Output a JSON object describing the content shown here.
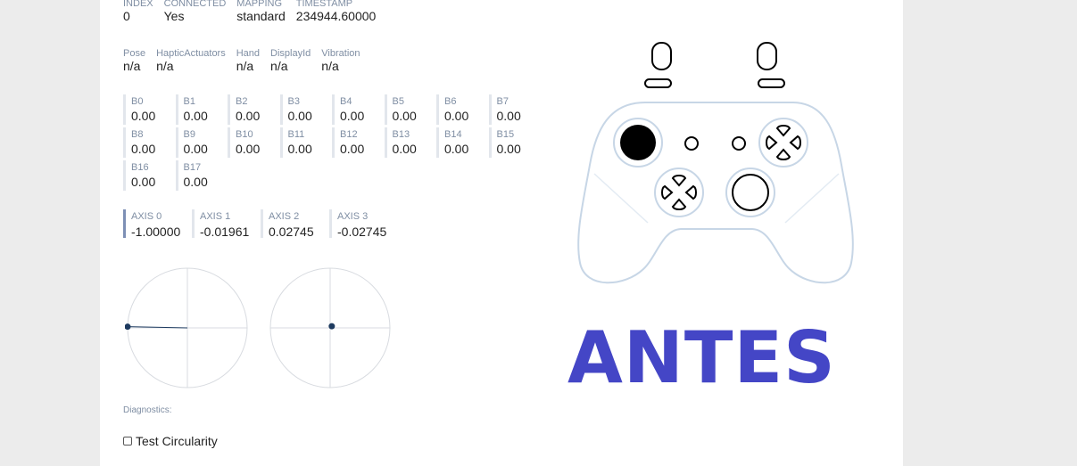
{
  "info": {
    "index": {
      "label": "INDEX",
      "value": "0"
    },
    "connected": {
      "label": "CONNECTED",
      "value": "Yes"
    },
    "mapping": {
      "label": "MAPPING",
      "value": "standard"
    },
    "timestamp": {
      "label": "TIMESTAMP",
      "value": "234944.60000"
    }
  },
  "info2": {
    "pose": {
      "label": "Pose",
      "value": "n/a"
    },
    "haptic": {
      "label": "HapticActuators",
      "value": "n/a"
    },
    "hand": {
      "label": "Hand",
      "value": "n/a"
    },
    "displayid": {
      "label": "DisplayId",
      "value": "n/a"
    },
    "vibration": {
      "label": "Vibration",
      "value": "n/a"
    }
  },
  "buttons": [
    {
      "label": "B0",
      "value": "0.00"
    },
    {
      "label": "B1",
      "value": "0.00"
    },
    {
      "label": "B2",
      "value": "0.00"
    },
    {
      "label": "B3",
      "value": "0.00"
    },
    {
      "label": "B4",
      "value": "0.00"
    },
    {
      "label": "B5",
      "value": "0.00"
    },
    {
      "label": "B6",
      "value": "0.00"
    },
    {
      "label": "B7",
      "value": "0.00"
    },
    {
      "label": "B8",
      "value": "0.00"
    },
    {
      "label": "B9",
      "value": "0.00"
    },
    {
      "label": "B10",
      "value": "0.00"
    },
    {
      "label": "B11",
      "value": "0.00"
    },
    {
      "label": "B12",
      "value": "0.00"
    },
    {
      "label": "B13",
      "value": "0.00"
    },
    {
      "label": "B14",
      "value": "0.00"
    },
    {
      "label": "B15",
      "value": "0.00"
    },
    {
      "label": "B16",
      "value": "0.00"
    },
    {
      "label": "B17",
      "value": "0.00"
    }
  ],
  "axes": [
    {
      "label": "AXIS 0",
      "value": "-1.00000"
    },
    {
      "label": "AXIS 1",
      "value": "-0.01961"
    },
    {
      "label": "AXIS 2",
      "value": "0.02745"
    },
    {
      "label": "AXIS 3",
      "value": "-0.02745"
    }
  ],
  "diagnostics": {
    "label": "Diagnostics:",
    "test_circularity": "Test Circularity",
    "checked": false
  },
  "overlay": {
    "text": "ANTES"
  },
  "colors": {
    "overlay_text": "#4446c6",
    "controller_outline": "#c7d6e6",
    "stick_dot": "#1d3a5f",
    "pressed_button": "#000000"
  }
}
